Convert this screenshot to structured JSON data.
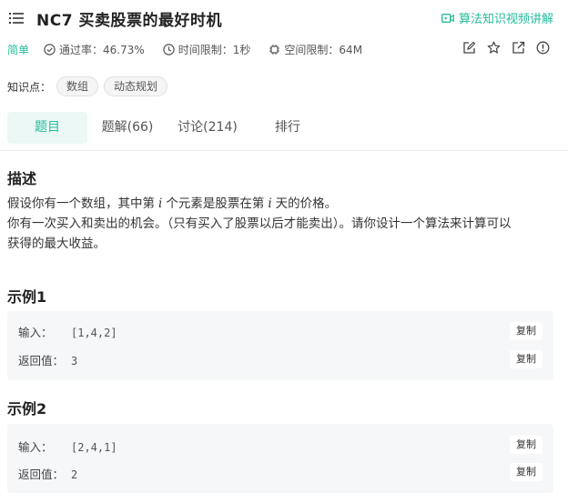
{
  "header": {
    "title": "NC7  买卖股票的最好时机",
    "video_link": "算法知识视频讲解"
  },
  "meta": {
    "difficulty": "简单",
    "pass_rate": "通过率：46.73%",
    "time_limit": "时间限制：1秒",
    "memory_limit": "空间限制：64M"
  },
  "tags": {
    "label": "知识点：",
    "items": [
      "数组",
      "动态规划"
    ]
  },
  "tabs": [
    {
      "label": "题目"
    },
    {
      "label": "题解(66)"
    },
    {
      "label": "讨论(214)"
    },
    {
      "label": "排行"
    }
  ],
  "description": {
    "heading": "描述",
    "line1_a": "假设你有一个数组，其中第",
    "var": "i",
    "line1_b": "个元素是股票在第",
    "line1_c": "天的价格。",
    "line2": "你有一次买入和卖出的机会。（只有买入了股票以后才能卖出）。请你设计一个算法来计算可以",
    "line3": "获得的最大收益。"
  },
  "examples": [
    {
      "heading": "示例1",
      "input_label": "输入：",
      "input_value": "[1,4,2]",
      "output_label": "返回值：",
      "output_value": "3",
      "copy_label": "复制"
    },
    {
      "heading": "示例2",
      "input_label": "输入：",
      "input_value": "[2,4,1]",
      "output_label": "返回值：",
      "output_value": "2",
      "copy_label": "复制"
    }
  ],
  "colors": {
    "accent": "#25bb9b",
    "tab_active_bg": "#ebf8f5",
    "example_bg": "#f6f7f9"
  }
}
